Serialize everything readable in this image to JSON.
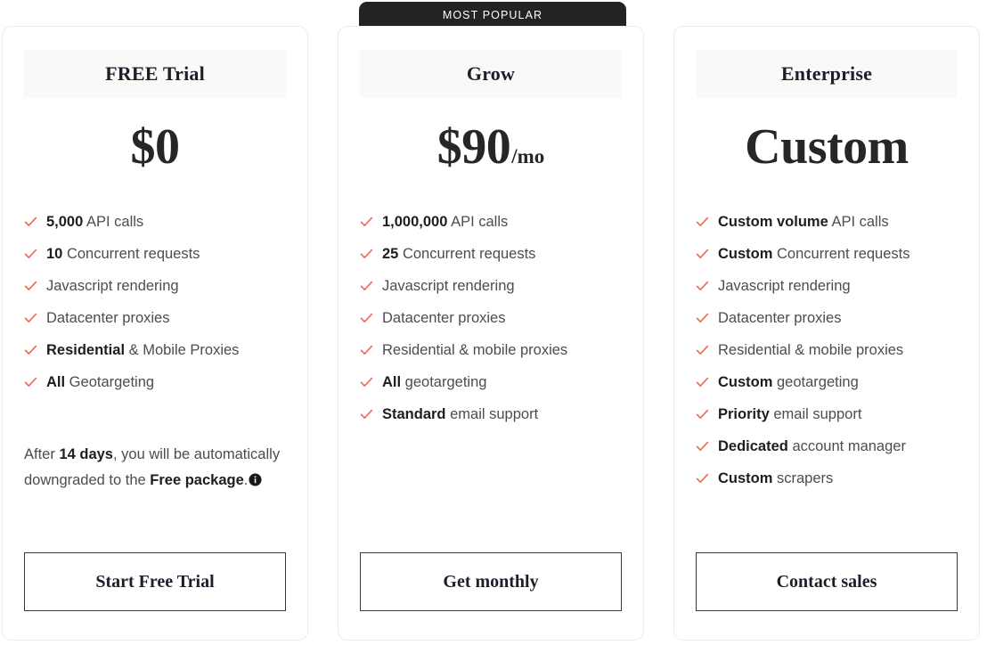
{
  "badge": {
    "label": "MOST POPULAR",
    "color": "#232323"
  },
  "accent": {
    "check_color": "#f26b55",
    "header_bg": "#faf9f8"
  },
  "icons": {
    "check": "check-icon",
    "info": "info-icon"
  },
  "plans": [
    {
      "name": "FREE Trial",
      "price": "$0",
      "price_suffix": "",
      "features": [
        {
          "strong": "5,000",
          "rest": " API calls"
        },
        {
          "strong": "10",
          "rest": " Concurrent requests"
        },
        {
          "strong": "",
          "rest": "Javascript rendering"
        },
        {
          "strong": "",
          "rest": "Datacenter proxies"
        },
        {
          "strong": "Residential",
          "rest": " & Mobile Proxies"
        },
        {
          "strong": "All",
          "rest": " Geotargeting"
        }
      ],
      "note": {
        "before": "After ",
        "strong1": "14 days",
        "middle": ", you will be automatically downgraded to the ",
        "strong2": "Free package",
        "after": "."
      },
      "cta": "Start Free Trial"
    },
    {
      "name": "Grow",
      "price": "$90",
      "price_suffix": "/mo",
      "features": [
        {
          "strong": "1,000,000",
          "rest": " API calls"
        },
        {
          "strong": "25",
          "rest": " Concurrent requests"
        },
        {
          "strong": "",
          "rest": "Javascript rendering"
        },
        {
          "strong": "",
          "rest": "Datacenter proxies"
        },
        {
          "strong": "",
          "rest": "Residential & mobile proxies"
        },
        {
          "strong": "All",
          "rest": " geotargeting"
        },
        {
          "strong": "Standard",
          "rest": " email support"
        }
      ],
      "note": null,
      "cta": "Get monthly"
    },
    {
      "name": "Enterprise",
      "price": "Custom",
      "price_suffix": "",
      "features": [
        {
          "strong": "Custom volume",
          "rest": " API calls"
        },
        {
          "strong": "Custom",
          "rest": " Concurrent requests"
        },
        {
          "strong": "",
          "rest": "Javascript rendering"
        },
        {
          "strong": "",
          "rest": "Datacenter proxies"
        },
        {
          "strong": "",
          "rest": "Residential & mobile proxies"
        },
        {
          "strong": "Custom",
          "rest": " geotargeting"
        },
        {
          "strong": "Priority",
          "rest": " email support"
        },
        {
          "strong": "Dedicated",
          "rest": " account manager"
        },
        {
          "strong": "Custom",
          "rest": " scrapers"
        }
      ],
      "note": null,
      "cta": "Contact sales"
    }
  ]
}
